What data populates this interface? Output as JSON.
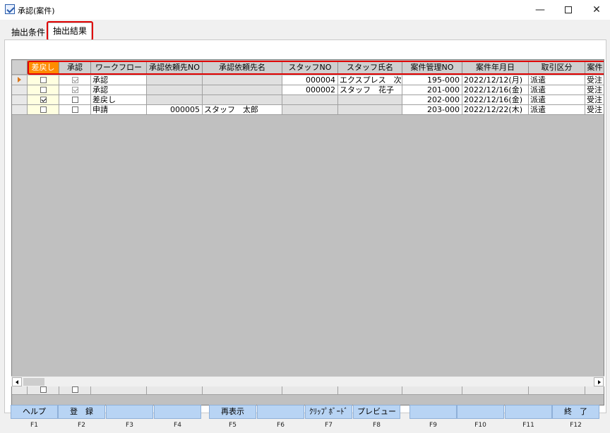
{
  "window": {
    "title": "承認(案件)",
    "minimize": "—",
    "maximize": "",
    "close": "✕"
  },
  "tabs": [
    {
      "label": "抽出条件"
    },
    {
      "label": "抽出結果"
    }
  ],
  "grid": {
    "columns": [
      "差戻し",
      "承認",
      "ワークフロー",
      "承認依頼先NO",
      "承認依頼先名",
      "スタッフNO",
      "スタッフ氏名",
      "案件管理NO",
      "案件年月日",
      "取引区分",
      "案件"
    ],
    "rows": [
      {
        "sashimodoshi": false,
        "shonin": true,
        "shonin_grey": true,
        "workflow": "承認",
        "irai_no": "",
        "irai_name": "",
        "staff_no": "000004",
        "staff_name": "エクスプレス　次",
        "anken_no": "195-000",
        "date": "2022/12/12(月)",
        "torihiki": "派遣",
        "anken": "受注"
      },
      {
        "sashimodoshi": false,
        "shonin": true,
        "shonin_grey": true,
        "workflow": "承認",
        "irai_no": "",
        "irai_name": "",
        "staff_no": "000002",
        "staff_name": "スタッフ　花子",
        "anken_no": "201-000",
        "date": "2022/12/16(金)",
        "torihiki": "派遣",
        "anken": "受注"
      },
      {
        "sashimodoshi": true,
        "shonin": false,
        "shonin_grey": false,
        "workflow": "差戻し",
        "irai_no": "",
        "irai_name": "",
        "staff_no": "",
        "staff_name": "",
        "anken_no": "202-000",
        "date": "2022/12/16(金)",
        "torihiki": "派遣",
        "anken": "受注"
      },
      {
        "sashimodoshi": false,
        "shonin": false,
        "shonin_grey": false,
        "workflow": "申請",
        "irai_no": "000005",
        "irai_name": "スタッフ　太郎",
        "staff_no": "",
        "staff_name": "",
        "anken_no": "203-000",
        "date": "2022/12/22(木)",
        "torihiki": "派遣",
        "anken": "受注"
      }
    ]
  },
  "fkeys": [
    {
      "key": "F1",
      "label": "ヘルプ"
    },
    {
      "key": "F2",
      "label": "登　録"
    },
    {
      "key": "F3",
      "label": ""
    },
    {
      "key": "F4",
      "label": ""
    },
    {
      "key": "F5",
      "label": "再表示"
    },
    {
      "key": "F6",
      "label": ""
    },
    {
      "key": "F7",
      "label": "ｸﾘｯﾌﾟﾎﾞｰﾄﾞ"
    },
    {
      "key": "F8",
      "label": "プレビュー"
    },
    {
      "key": "F9",
      "label": ""
    },
    {
      "key": "F10",
      "label": ""
    },
    {
      "key": "F11",
      "label": ""
    },
    {
      "key": "F12",
      "label": "終　了"
    }
  ]
}
